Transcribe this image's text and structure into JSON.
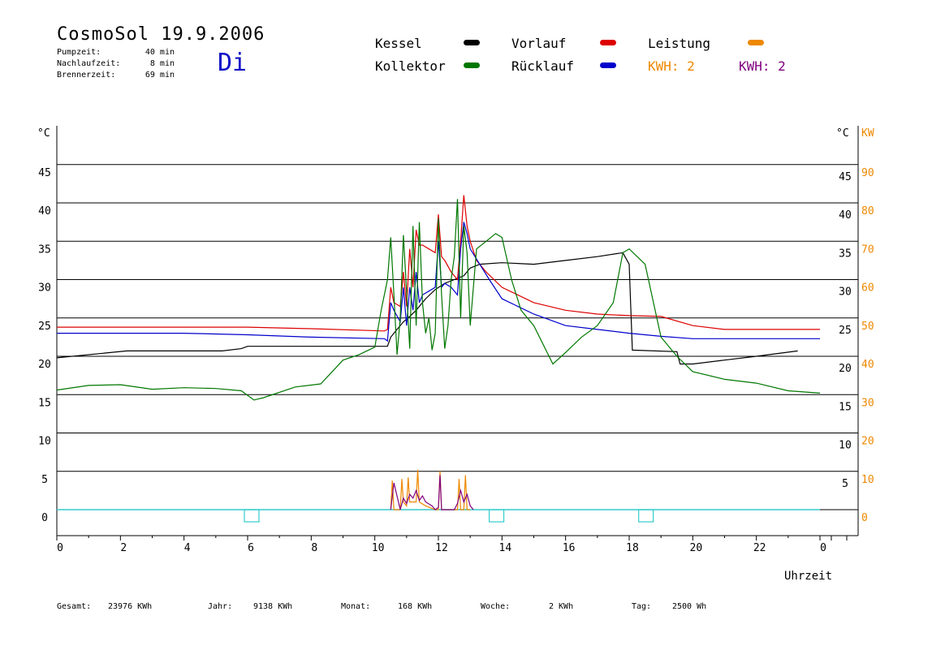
{
  "header": {
    "title": "CosmoSol 19.9.2006",
    "weekday": "Di",
    "stats": [
      {
        "label": "Pumpzeit:",
        "value": "40 min"
      },
      {
        "label": "Nachlaufzeit:",
        "value": "8 min"
      },
      {
        "label": "Brennerzeit:",
        "value": "69 min"
      }
    ]
  },
  "legend": {
    "kessel": "Kessel",
    "vorlauf": "Vorlauf",
    "leistung": "Leistung",
    "kollektor": "Kollektor",
    "ruecklauf": "Rücklauf",
    "kwh_orange": "KWH: 2",
    "kwh_purple": "KWH: 2"
  },
  "footer": {
    "gesamt_label": "Gesamt:",
    "gesamt_value": "23976 KWh",
    "jahr_label": "Jahr:",
    "jahr_value": "9138 KWh",
    "monat_label": "Monat:",
    "monat_value": "168 KWh",
    "woche_label": "Woche:",
    "woche_value": "2 KWh",
    "tag_label": "Tag:",
    "tag_value": "2500 Wh"
  },
  "colors": {
    "kessel": "#000000",
    "vorlauf": "#dd0000",
    "ruecklauf": "#0000cc",
    "kollektor": "#007700",
    "leistung": "#ee8800",
    "leistung2": "#800080",
    "pump": "#33cccc",
    "kw_axis": "#ee8800",
    "weekday": "#1010c8"
  },
  "chart_data": {
    "type": "line",
    "xlabel": "Uhrzeit",
    "x_ticks": [
      "0",
      "2",
      "4",
      "6",
      "8",
      "10",
      "12",
      "14",
      "16",
      "18",
      "20",
      "22",
      "0"
    ],
    "xlim": [
      0,
      24
    ],
    "ylabel_left": "°C",
    "ylabel_right": "°C",
    "ylabel_right2": "KW",
    "ylim": [
      0,
      45
    ],
    "y_ticks_left": [
      "45",
      "40",
      "35",
      "30",
      "25",
      "20",
      "15",
      "10",
      "5",
      "0"
    ],
    "y_ticks_right": [
      "45",
      "40",
      "35",
      "30",
      "25",
      "20",
      "15",
      "10",
      "5"
    ],
    "y_ticks_kw": [
      "90",
      "80",
      "70",
      "60",
      "50",
      "40",
      "30",
      "20",
      "10",
      "0"
    ],
    "series": [
      {
        "name": "Kessel",
        "color": "#000000",
        "x": [
          0,
          2.2,
          5.2,
          5.8,
          6.0,
          8,
          10.4,
          10.5,
          10.7,
          10.9,
          11.1,
          11.3,
          11.6,
          11.9,
          12.2,
          12.5,
          12.8,
          13.0,
          13.3,
          14,
          15,
          16,
          17,
          17.8,
          18.0,
          18.1,
          19.5,
          19.6,
          20,
          21,
          22,
          23.3
        ],
        "y": [
          19.8,
          20.7,
          20.7,
          21.0,
          21.3,
          21.3,
          21.3,
          22.5,
          23.5,
          24.5,
          25.2,
          26.0,
          27.5,
          28.7,
          29.5,
          30.0,
          30.5,
          31.5,
          32.0,
          32.2,
          32.0,
          32.5,
          33.0,
          33.5,
          32.0,
          20.8,
          20.6,
          19.0,
          19.0,
          19.5,
          20.0,
          20.7
        ]
      },
      {
        "name": "Vorlauf",
        "color": "#dd0000",
        "x": [
          0,
          4,
          6,
          8,
          10.3,
          10.4,
          10.5,
          10.6,
          10.8,
          10.9,
          11.0,
          11.1,
          11.2,
          11.3,
          11.4,
          11.5,
          11.7,
          11.9,
          12.0,
          12.1,
          12.2,
          12.4,
          12.6,
          12.7,
          12.8,
          12.9,
          13.0,
          13.2,
          13.5,
          14,
          15,
          16,
          17,
          18,
          19,
          20,
          21,
          22,
          24
        ],
        "y": [
          23.8,
          23.8,
          23.8,
          23.6,
          23.3,
          23.5,
          29.0,
          27.0,
          26.5,
          31.0,
          26.5,
          34.0,
          29.0,
          36.5,
          34.5,
          34.5,
          34.0,
          33.5,
          38.5,
          33.0,
          32.5,
          31.0,
          30.0,
          35.0,
          41.0,
          37.0,
          35.0,
          32.5,
          31.0,
          29.0,
          27.0,
          26.0,
          25.5,
          25.3,
          25.2,
          24.0,
          23.5,
          23.5,
          23.5
        ]
      },
      {
        "name": "Rücklauf",
        "color": "#0000cc",
        "x": [
          0,
          4,
          6,
          8,
          10.3,
          10.4,
          10.5,
          10.6,
          10.8,
          10.9,
          11.0,
          11.1,
          11.2,
          11.3,
          11.4,
          11.5,
          11.7,
          11.9,
          12.0,
          12.1,
          12.2,
          12.4,
          12.6,
          12.7,
          12.8,
          12.9,
          13.0,
          13.3,
          13.6,
          14,
          15,
          16,
          17,
          18,
          19,
          20,
          22,
          24
        ],
        "y": [
          23.0,
          23.0,
          22.8,
          22.5,
          22.3,
          22.0,
          27.0,
          26.0,
          24.5,
          29.0,
          24.0,
          29.0,
          26.0,
          31.0,
          27.0,
          28.0,
          28.5,
          29.0,
          35.0,
          29.0,
          29.5,
          29.0,
          28.0,
          34.0,
          37.5,
          36.0,
          34.0,
          32.0,
          30.0,
          27.5,
          25.5,
          24.0,
          23.5,
          23.0,
          22.6,
          22.3,
          22.3,
          22.3
        ]
      },
      {
        "name": "Kollektor",
        "color": "#007700",
        "x": [
          0,
          1,
          2,
          3,
          4,
          5,
          5.8,
          6.2,
          6.5,
          7.5,
          8.3,
          9.0,
          9.5,
          10.0,
          10.2,
          10.4,
          10.5,
          10.6,
          10.7,
          10.8,
          10.9,
          11.0,
          11.1,
          11.2,
          11.3,
          11.4,
          11.5,
          11.6,
          11.7,
          11.8,
          11.9,
          12.0,
          12.1,
          12.2,
          12.3,
          12.4,
          12.5,
          12.6,
          12.7,
          12.8,
          12.9,
          13.0,
          13.2,
          13.5,
          13.8,
          14.0,
          14.3,
          14.6,
          15.0,
          15.6,
          16.0,
          16.5,
          17.0,
          17.5,
          17.8,
          18.0,
          18.5,
          19.0,
          19.5,
          20.0,
          21.0,
          22.0,
          23.0,
          24.0
        ],
        "y": [
          15.6,
          16.2,
          16.3,
          15.7,
          15.9,
          15.8,
          15.5,
          14.3,
          14.6,
          16.0,
          16.4,
          19.5,
          20.2,
          21.2,
          26.0,
          30.0,
          35.5,
          28.0,
          20.2,
          25.0,
          35.8,
          28.5,
          21.0,
          37.0,
          24.0,
          37.5,
          27.0,
          23.0,
          25.0,
          20.8,
          23.0,
          38.0,
          28.0,
          21.0,
          24.0,
          30.0,
          33.0,
          40.5,
          25.0,
          37.0,
          33.5,
          24.0,
          34.0,
          35.0,
          36.0,
          35.5,
          30.0,
          26.0,
          24.0,
          19.0,
          20.5,
          22.5,
          24.0,
          27.0,
          33.5,
          34.0,
          32.0,
          22.5,
          20.0,
          18.0,
          17.0,
          16.5,
          15.5,
          15.2
        ]
      },
      {
        "name": "Leistung",
        "color": "#ee8800",
        "x": [
          10.5,
          10.55,
          10.6,
          10.8,
          10.85,
          10.9,
          11.0,
          11.05,
          11.1,
          11.3,
          11.35,
          11.4,
          11.6,
          11.9,
          12.0,
          12.05,
          12.1,
          12.6,
          12.65,
          12.7,
          12.8,
          12.85,
          12.9,
          13.0
        ],
        "y": [
          0,
          3.8,
          0,
          0,
          4.0,
          1.0,
          0.5,
          4.2,
          1.0,
          1.0,
          5.2,
          1.0,
          0.5,
          0,
          0,
          5.0,
          0,
          0,
          4.0,
          0,
          0,
          4.5,
          0,
          0
        ]
      },
      {
        "name": "Leistung2",
        "color": "#800080",
        "x": [
          10.5,
          10.6,
          10.8,
          10.9,
          11.0,
          11.1,
          11.2,
          11.3,
          11.4,
          11.5,
          11.6,
          11.8,
          11.9,
          12.0,
          12.05,
          12.1,
          12.3,
          12.5,
          12.6,
          12.7,
          12.8,
          12.9,
          13.0,
          13.1
        ],
        "y": [
          0,
          3.5,
          0,
          1.5,
          0.8,
          2.0,
          1.5,
          2.5,
          1.2,
          1.8,
          1.0,
          0.5,
          0,
          0.3,
          4.5,
          0,
          0,
          0,
          0.8,
          2.5,
          1.0,
          2.0,
          0.5,
          0
        ]
      }
    ],
    "pump_markers_x": [
      6.0,
      13.7,
      18.4
    ],
    "grid": "horizontal",
    "legend_position": "top"
  }
}
